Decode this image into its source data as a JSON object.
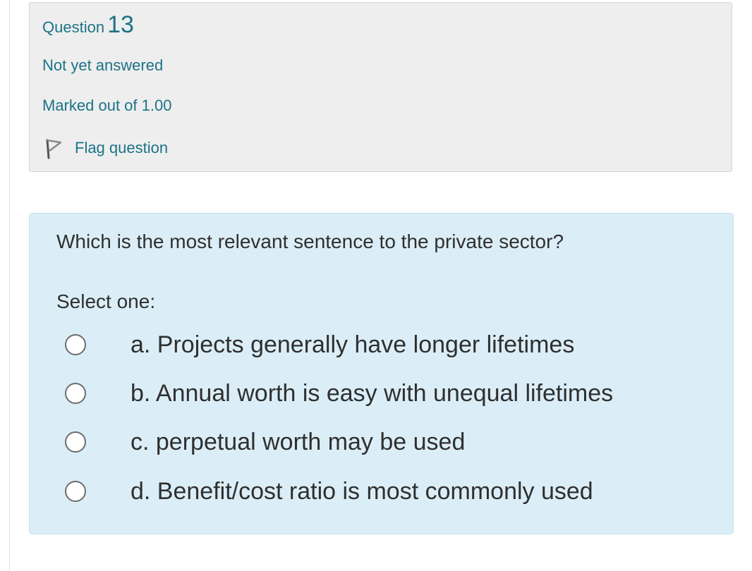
{
  "info": {
    "question_label": "Question",
    "question_number": "13",
    "state": "Not yet answered",
    "grade": "Marked out of 1.00",
    "flag_label": "Flag question",
    "flag_icon": "flag-outline-icon"
  },
  "question": {
    "text": "Which is the most relevant sentence to the private sector?",
    "prompt": "Select one:",
    "answers": [
      {
        "label": "a. Projects generally have longer lifetimes",
        "selected": false
      },
      {
        "label": "b. Annual worth is easy with unequal lifetimes",
        "selected": false
      },
      {
        "label": "c. perpetual worth may be used",
        "selected": false
      },
      {
        "label": "d. Benefit/cost ratio is most commonly used",
        "selected": false
      }
    ]
  },
  "colors": {
    "link_teal": "#1c7387",
    "info_background": "#eeeeee",
    "content_background": "#dbeef7",
    "text_dark": "#2f2f2f"
  }
}
